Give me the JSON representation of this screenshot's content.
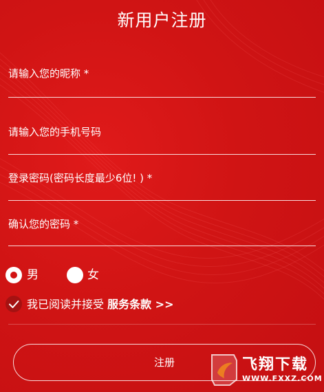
{
  "page": {
    "title": "新用户注册"
  },
  "form": {
    "nickname_label": "请输入您的昵称 *",
    "phone_label": "请输入您的手机号码",
    "password_label": "登录密码(密码长度最少6位! ) *",
    "confirm_label": "确认您的密码 *"
  },
  "gender": {
    "male": "男",
    "female": "女",
    "selected": "男"
  },
  "agreement": {
    "text": "我已阅读并接受 ",
    "link": "服务条款 >>",
    "checked": true
  },
  "actions": {
    "register_label": "注册"
  },
  "watermark": {
    "brand": "飞翔下载",
    "url": "WWW.FXXZ.COM"
  },
  "colors": {
    "background": "#d01414",
    "accent": "#ffffff",
    "check": "#a51212"
  }
}
